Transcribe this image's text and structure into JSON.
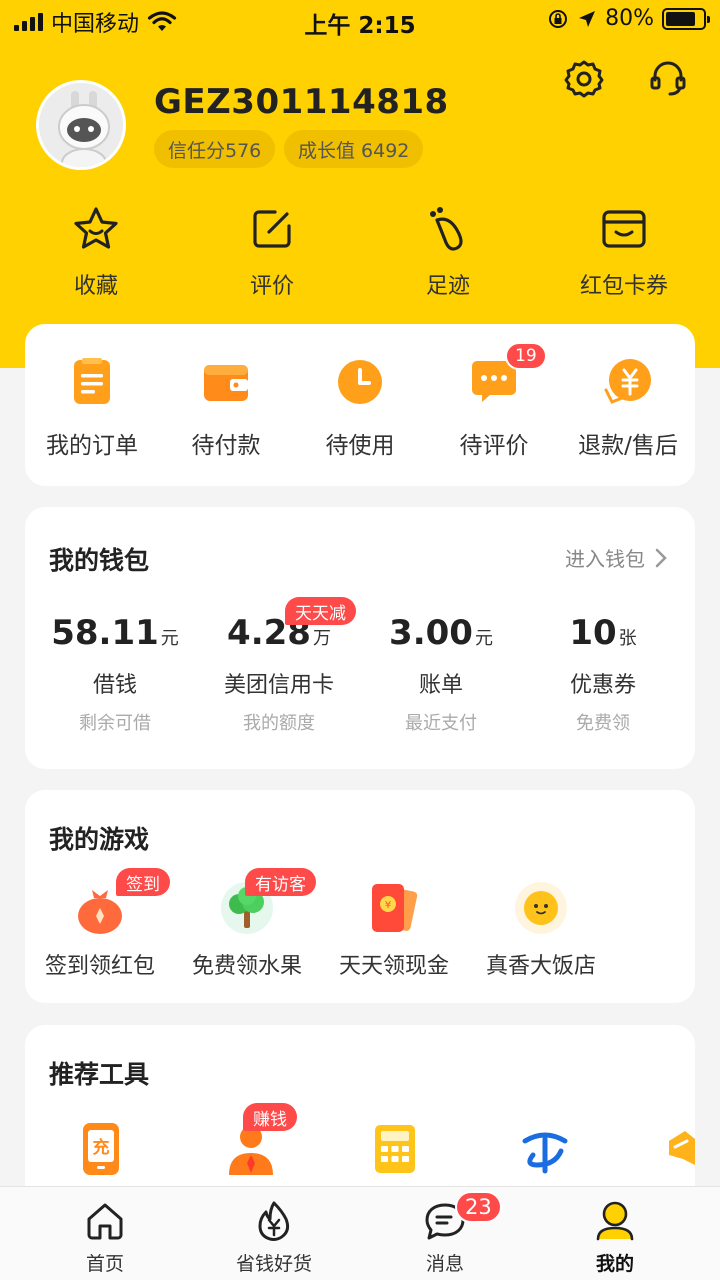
{
  "status_bar": {
    "carrier": "中国移动",
    "time": "上午 2:15",
    "battery": "80%",
    "battery_level": 0.8
  },
  "profile": {
    "username": "GEZ301114818",
    "trust_score": "信任分576",
    "growth_value": "成长值 6492"
  },
  "shortcuts": [
    {
      "label": "收藏",
      "icon": "star-icon"
    },
    {
      "label": "评价",
      "icon": "edit-icon"
    },
    {
      "label": "足迹",
      "icon": "footprint-icon"
    },
    {
      "label": "红包卡券",
      "icon": "wallet-card-icon"
    }
  ],
  "orders": {
    "items": [
      {
        "label": "我的订单",
        "icon": "order-list-icon"
      },
      {
        "label": "待付款",
        "icon": "wallet-icon"
      },
      {
        "label": "待使用",
        "icon": "clock-icon"
      },
      {
        "label": "待评价",
        "icon": "chat-bubble-icon",
        "badge": "19"
      },
      {
        "label": "退款/售后",
        "icon": "refund-icon"
      }
    ]
  },
  "wallet": {
    "title": "我的钱包",
    "link": "进入钱包",
    "items": [
      {
        "value": "58.11",
        "unit": "元",
        "name": "借钱",
        "sub": "剩余可借"
      },
      {
        "value": "4.28",
        "unit": "万",
        "name": "美团信用卡",
        "sub": "我的额度",
        "tag": "天天减"
      },
      {
        "value": "3.00",
        "unit": "元",
        "name": "账单",
        "sub": "最近支付"
      },
      {
        "value": "10",
        "unit": "张",
        "name": "优惠券",
        "sub": "免费领"
      }
    ]
  },
  "games": {
    "title": "我的游戏",
    "items": [
      {
        "label": "签到领红包",
        "tag": "签到",
        "icon": "money-bag-icon"
      },
      {
        "label": "免费领水果",
        "tag": "有访客",
        "icon": "fruit-tree-icon"
      },
      {
        "label": "天天领现金",
        "icon": "red-envelope-icon"
      },
      {
        "label": "真香大饭店",
        "icon": "egg-face-icon"
      }
    ]
  },
  "tools": {
    "title": "推荐工具",
    "items": [
      {
        "icon": "phone-recharge-icon"
      },
      {
        "icon": "person-earn-icon",
        "tag": "赚钱"
      },
      {
        "icon": "calculator-icon"
      },
      {
        "icon": "telecom-icon"
      },
      {
        "icon": "handshake-icon"
      }
    ]
  },
  "tab_bar": {
    "tabs": [
      {
        "label": "首页",
        "icon": "home-icon"
      },
      {
        "label": "省钱好货",
        "icon": "yen-flame-icon"
      },
      {
        "label": "消息",
        "icon": "message-icon",
        "badge": "23"
      },
      {
        "label": "我的",
        "icon": "profile-icon",
        "active": true
      }
    ]
  }
}
